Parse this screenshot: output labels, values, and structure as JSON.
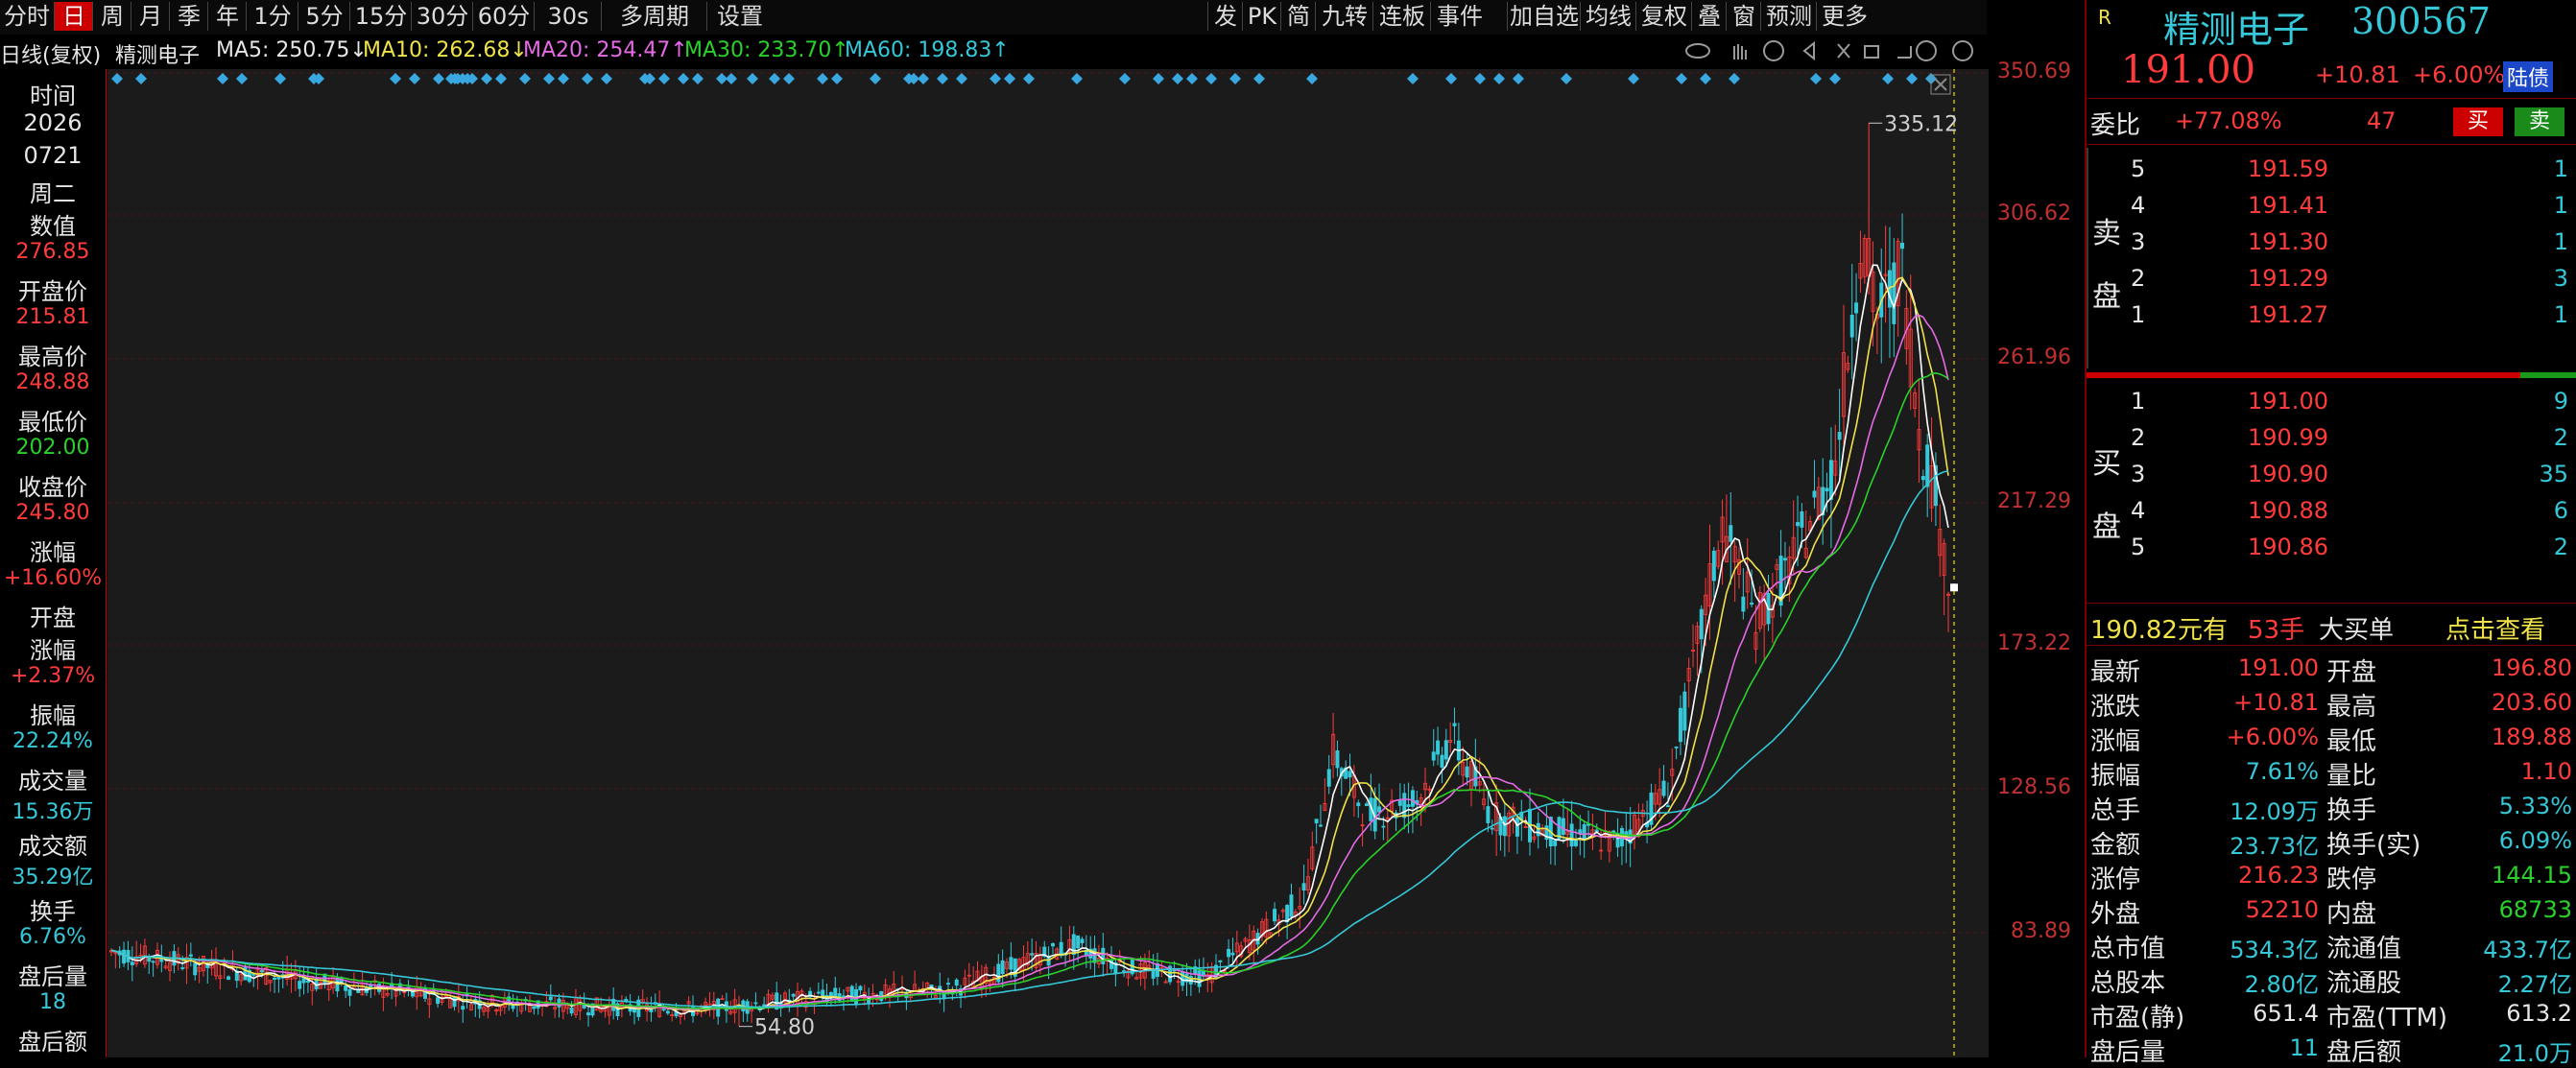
{
  "toolbar": {
    "items": [
      "分时",
      "日",
      "周",
      "月",
      "季",
      "年",
      "1分",
      "5分",
      "15分",
      "30分",
      "60分",
      "30s",
      "多周期",
      "设置"
    ],
    "right_items": [
      "发",
      "PK",
      "简",
      "九转",
      "连板",
      "事件",
      "加自选",
      "均线",
      "复权",
      "叠",
      "窗",
      "预测",
      "更多"
    ]
  },
  "ma_line": {
    "title": "日线(复权)",
    "stock_name": "精测电子",
    "ma5": "MA5: 250.75↓",
    "ma10": "MA10: 262.68↓",
    "ma20": "MA20: 254.47↑",
    "ma30": "MA30: 233.70↑",
    "ma60": "MA60: 198.83↑"
  },
  "left_panel": {
    "time_label": "时间",
    "year": "2026",
    "date": "0721",
    "weekday": "周二",
    "value_label": "数值",
    "value": "276.85",
    "open_label": "开盘价",
    "open": "215.81",
    "high_label": "最高价",
    "high": "248.88",
    "low_label": "最低价",
    "low": "202.00",
    "close_label": "收盘价",
    "close": "245.80",
    "chg_label": "涨幅",
    "chg": "+16.60%",
    "open_chg_label1": "开盘",
    "open_chg_label2": "涨幅",
    "open_chg": "+2.37%",
    "amp_label": "振幅",
    "amp": "22.24%",
    "vol_label": "成交量",
    "vol": "15.36万",
    "amount_label": "成交额",
    "amount": "35.29亿",
    "turnover_label": "换手",
    "turnover": "6.76%",
    "after_vol_label": "盘后量",
    "after_vol": "18",
    "after_amount_label": "盘后额"
  },
  "axis": {
    "ticks": [
      "350.69",
      "306.62",
      "261.96",
      "217.29",
      "173.22",
      "128.56",
      "83.89"
    ],
    "max_label": "335.12",
    "min_label": "54.80"
  },
  "quote": {
    "badge": "R",
    "name": "精测电子",
    "code": "300567",
    "price": "191.00",
    "change": "+10.81",
    "change_pct": "+6.00%",
    "tag": "陆债",
    "weibi_label": "委比",
    "weibi": "+77.08%",
    "weicha": "47",
    "buy_btn": "买",
    "sell_btn": "卖",
    "sell_label": [
      "卖",
      "盘"
    ],
    "buy_label": [
      "买",
      "盘"
    ],
    "asks": [
      {
        "lvl": "5",
        "price": "191.59",
        "vol": "1"
      },
      {
        "lvl": "4",
        "price": "191.41",
        "vol": "1"
      },
      {
        "lvl": "3",
        "price": "191.30",
        "vol": "1"
      },
      {
        "lvl": "2",
        "price": "191.29",
        "vol": "3"
      },
      {
        "lvl": "1",
        "price": "191.27",
        "vol": "1"
      }
    ],
    "bids": [
      {
        "lvl": "1",
        "price": "191.00",
        "vol": "9"
      },
      {
        "lvl": "2",
        "price": "190.99",
        "vol": "2"
      },
      {
        "lvl": "3",
        "price": "190.90",
        "vol": "35"
      },
      {
        "lvl": "4",
        "price": "190.88",
        "vol": "6"
      },
      {
        "lvl": "5",
        "price": "190.86",
        "vol": "2"
      }
    ],
    "big_order_price": "190.82元有",
    "big_order_vol": "53手",
    "big_order_label": "大买单",
    "big_order_link": "点击查看",
    "stats": [
      {
        "l1": "最新",
        "v1": "191.00",
        "c1": "red",
        "l2": "开盘",
        "v2": "196.80",
        "c2": "red"
      },
      {
        "l1": "涨跌",
        "v1": "+10.81",
        "c1": "red",
        "l2": "最高",
        "v2": "203.60",
        "c2": "red"
      },
      {
        "l1": "涨幅",
        "v1": "+6.00%",
        "c1": "red",
        "l2": "最低",
        "v2": "189.88",
        "c2": "red"
      },
      {
        "l1": "振幅",
        "v1": "7.61%",
        "c1": "cyn",
        "l2": "量比",
        "v2": "1.10",
        "c2": "red"
      },
      {
        "l1": "总手",
        "v1": "12.09万",
        "c1": "cyn",
        "l2": "换手",
        "v2": "5.33%",
        "c2": "cyn"
      },
      {
        "l1": "金额",
        "v1": "23.73亿",
        "c1": "cyn",
        "l2": "换手(实)",
        "v2": "6.09%",
        "c2": "cyn"
      },
      {
        "l1": "涨停",
        "v1": "216.23",
        "c1": "red",
        "l2": "跌停",
        "v2": "144.15",
        "c2": "grn"
      },
      {
        "l1": "外盘",
        "v1": "52210",
        "c1": "red",
        "l2": "内盘",
        "v2": "68733",
        "c2": "grn"
      },
      {
        "l1": "总市值",
        "v1": "534.3亿",
        "c1": "cyn",
        "l2": "流通值",
        "v2": "433.7亿",
        "c2": "cyn"
      },
      {
        "l1": "总股本",
        "v1": "2.80亿",
        "c1": "cyn",
        "l2": "流通股",
        "v2": "2.27亿",
        "c2": "cyn"
      },
      {
        "l1": "市盈(静)",
        "v1": "651.4",
        "c1": "wht",
        "l2": "市盈(TTM)",
        "v2": "613.2",
        "c2": "wht"
      },
      {
        "l1": "盘后量",
        "v1": "11",
        "c1": "cyn",
        "l2": "盘后额",
        "v2": "21.0万",
        "c2": "cyn"
      }
    ]
  },
  "colors": {
    "up": "#ff3b3b",
    "down": "#2ad12a",
    "ma5": "#ffffff",
    "ma10": "#f0e24a",
    "ma20": "#e56ae5",
    "ma30": "#2ad12a",
    "ma60": "#35c8d8"
  }
}
